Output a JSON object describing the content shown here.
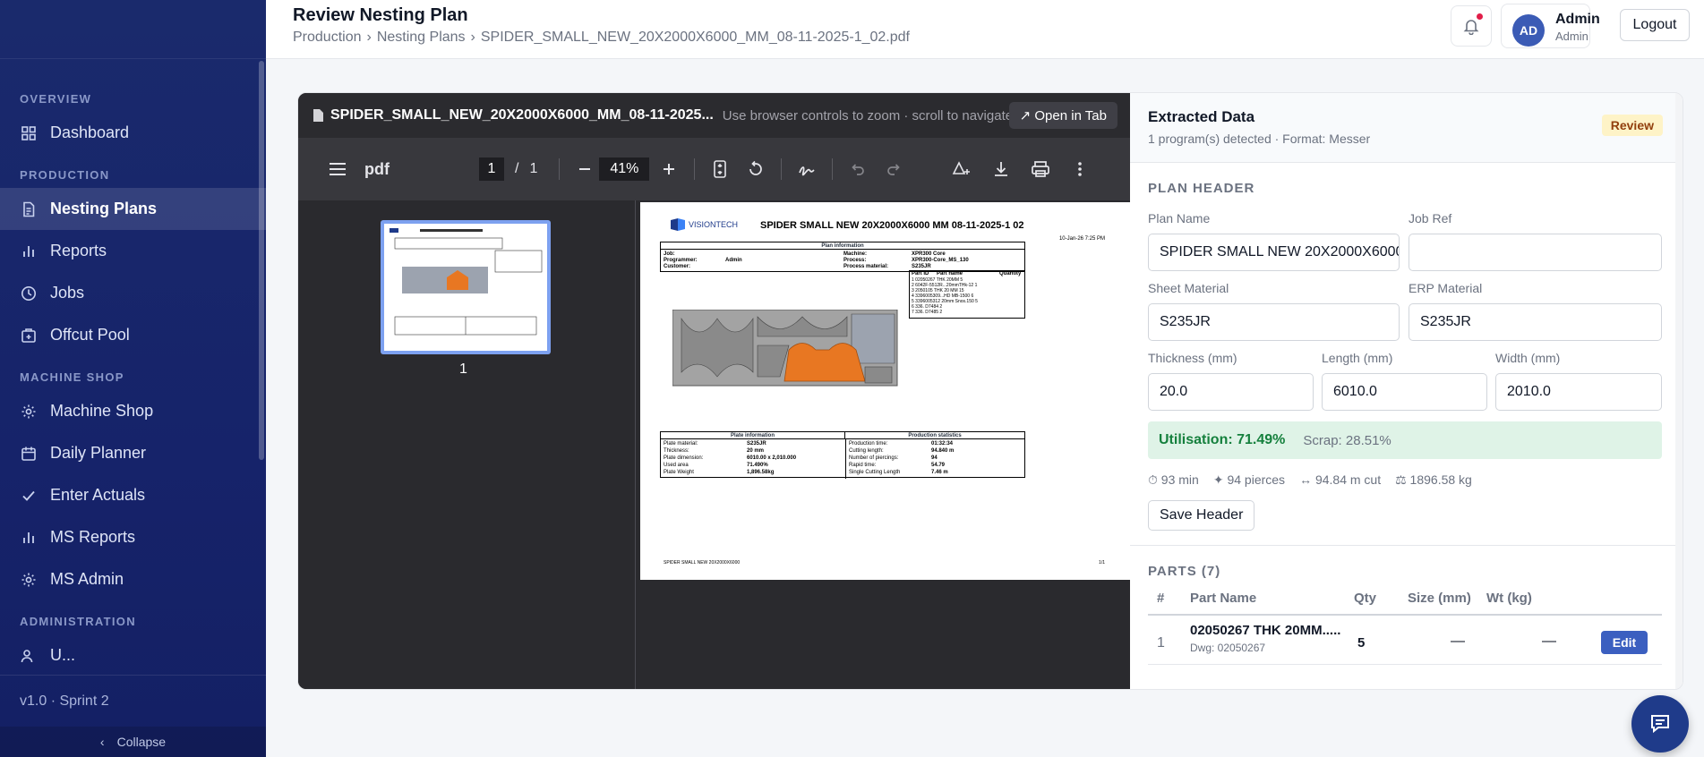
{
  "sidebar": {
    "sections": {
      "overview": "OVERVIEW",
      "production": "PRODUCTION",
      "machine_shop": "MACHINE SHOP",
      "administration": "ADMINISTRATION"
    },
    "items": [
      {
        "label": "Dashboard",
        "icon": "grid-icon"
      },
      {
        "label": "Nesting Plans",
        "icon": "document-icon",
        "active": true
      },
      {
        "label": "Reports",
        "icon": "bar-chart-icon"
      },
      {
        "label": "Jobs",
        "icon": "clock-icon"
      },
      {
        "label": "Offcut Pool",
        "icon": "box-icon"
      },
      {
        "label": "Machine Shop",
        "icon": "cog-icon"
      },
      {
        "label": "Daily Planner",
        "icon": "calendar-icon"
      },
      {
        "label": "Enter Actuals",
        "icon": "check-icon"
      },
      {
        "label": "MS Reports",
        "icon": "bar-chart-icon"
      },
      {
        "label": "MS Admin",
        "icon": "cog-icon"
      },
      {
        "label": "U...",
        "icon": "users-icon"
      }
    ],
    "version": "v1.0 · Sprint 2",
    "collapse_label": "Collapse"
  },
  "header": {
    "title": "Review Nesting Plan",
    "breadcrumb": [
      "Production",
      "›",
      "Nesting Plans",
      "›",
      "SPIDER_SMALL_NEW_20X2000X6000_MM_08-11-2025-1_02.pdf"
    ],
    "user": {
      "initials": "AD",
      "name": "Admin",
      "role": "Admin"
    },
    "logout_label": "Logout"
  },
  "pdf": {
    "filename": "SPIDER_SMALL_NEW_20X2000X6000_MM_08-11-2025...",
    "hint": "Use browser controls to zoom · scroll to navigate",
    "open_tab_label": "↗ Open in Tab",
    "toolbar": {
      "label": "pdf",
      "page_current": "1",
      "page_sep": "/",
      "page_total": "1",
      "zoom": "41%"
    },
    "thumb_number": "1",
    "page": {
      "brand": "VISIONTECH",
      "title": "SPIDER SMALL NEW 20X2000X6000 MM 08-11-2025-1 02",
      "date": "10-Jan-26 7:25 PM",
      "plan_info_header": "Plan information",
      "plan_info": [
        {
          "label": "Job:",
          "value": ""
        },
        {
          "label": "Programmer:",
          "value": "Admin"
        },
        {
          "label": "Customer:",
          "value": ""
        }
      ],
      "plan_info_right": [
        {
          "label": "Machine:",
          "value": "XPR300 Core"
        },
        {
          "label": "Process:",
          "value": "XPR300-Core_MS_130"
        },
        {
          "label": "Process material:",
          "value": "S235JR"
        },
        {
          "label": "Quantity:",
          "value": "1"
        }
      ],
      "parts_header": [
        "Part ID",
        "Part name",
        "Quantity"
      ],
      "parts": [
        [
          "1",
          "02050267 THK 20MM",
          "5"
        ],
        [
          "2",
          "6042F-5512R...20mmTHk-12",
          "1"
        ],
        [
          "3",
          "2050105 THK 20 MM",
          "15"
        ],
        [
          "4",
          "3396005309...HD MB-1500",
          "6"
        ],
        [
          "5",
          "3396005312 20mm Snos.150",
          "5"
        ],
        [
          "6",
          "336. D7484",
          "2"
        ],
        [
          "7",
          "336. D7485",
          "2"
        ]
      ],
      "plate_info_header": "Plate information",
      "plate_info": [
        {
          "label": "Plate material:",
          "value": "S235JR"
        },
        {
          "label": "Thickness:",
          "value": "20 mm"
        },
        {
          "label": "Plate dimension:",
          "value": "6010.00 x 2,010.000"
        },
        {
          "label": "Used area",
          "value": "71.490%"
        },
        {
          "label": "Plate Weight",
          "value": "1,896.58kg"
        }
      ],
      "prod_stats_header": "Production statistics",
      "prod_stats": [
        {
          "label": "Production time:",
          "value": "01:32:34"
        },
        {
          "label": "Cutting length:",
          "value": "94.840 m"
        },
        {
          "label": "Number of piercings:",
          "value": "94"
        },
        {
          "label": "Rapid time:",
          "value": "54.79"
        },
        {
          "label": "Single Cutting Length",
          "value": "7.46 m"
        }
      ],
      "footer": "SPIDER SMALL NEW 20X2000X6000",
      "page_of": "1/1"
    }
  },
  "extracted": {
    "title": "Extracted Data",
    "subtitle": "1 program(s) detected · Format: Messer",
    "badge": "Review",
    "plan_header_label": "PLAN HEADER",
    "fields": {
      "plan_name": {
        "label": "Plan Name",
        "value": "SPIDER SMALL NEW 20X2000X6000"
      },
      "job_ref": {
        "label": "Job Ref",
        "value": ""
      },
      "sheet_material": {
        "label": "Sheet Material",
        "value": "S235JR"
      },
      "erp_material": {
        "label": "ERP Material",
        "value": "S235JR"
      },
      "thickness": {
        "label": "Thickness (mm)",
        "value": "20.0"
      },
      "length": {
        "label": "Length (mm)",
        "value": "6010.0"
      },
      "width": {
        "label": "Width (mm)",
        "value": "2010.0"
      }
    },
    "utilisation": "Utilisation: 71.49%",
    "scrap": "Scrap: 28.51%",
    "stats": {
      "time": "⏱ 93 min",
      "pierces": "✦ 94 pierces",
      "cut": "↔ 94.84 m cut",
      "weight": "⚖ 1896.58 kg"
    },
    "save_label": "Save Header",
    "parts_label": "PARTS (7)",
    "parts_columns": [
      "#",
      "Part Name",
      "Qty",
      "Size (mm)",
      "Wt (kg)"
    ],
    "parts": [
      {
        "num": "1",
        "name": "02050267 THK 20MM.....",
        "dwg": "Dwg: 02050267",
        "qty": "5",
        "size": "—",
        "wt": "—",
        "edit": "Edit"
      }
    ]
  },
  "colors": {
    "sidebar_bg": "#1a2a6c",
    "accent": "#3b5fc0",
    "success": "#15803d",
    "warning_badge": "#fef3c7",
    "part_highlight": "#e87722"
  }
}
